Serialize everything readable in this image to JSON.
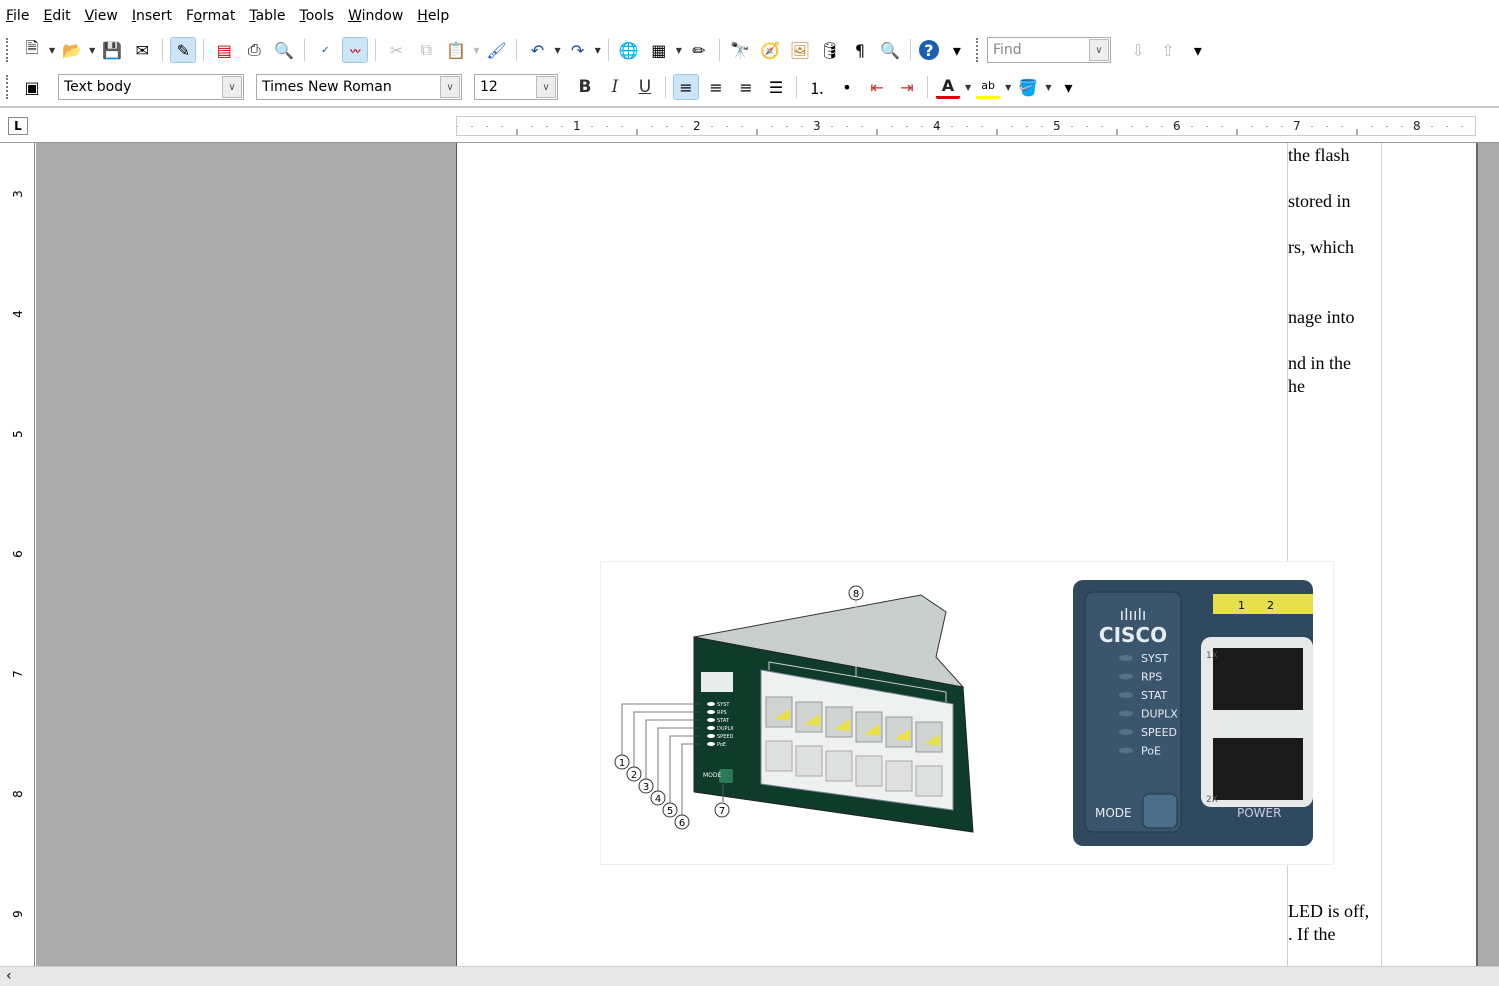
{
  "menubar": {
    "items": [
      {
        "label": "File",
        "u": "F",
        "rest": "ile"
      },
      {
        "label": "Edit",
        "u": "E",
        "rest": "dit"
      },
      {
        "label": "View",
        "u": "V",
        "rest": "iew"
      },
      {
        "label": "Insert",
        "u": "I",
        "rest": "nsert"
      },
      {
        "label": "Format",
        "pre": "F",
        "u": "o",
        "rest": "rmat"
      },
      {
        "label": "Table",
        "u": "T",
        "rest": "able"
      },
      {
        "label": "Tools",
        "u": "T",
        "rest": "ools"
      },
      {
        "label": "Window",
        "u": "W",
        "rest": "indow"
      },
      {
        "label": "Help",
        "u": "H",
        "rest": "elp"
      }
    ]
  },
  "toolbar": {
    "find_placeholder": "Find"
  },
  "formatting": {
    "paragraph_style": "Text body",
    "font_name": "Times New Roman",
    "font_size": "12",
    "bold": "B",
    "italic": "I",
    "underline": "U"
  },
  "ruler": {
    "h_numbers": [
      "1",
      "2",
      "3",
      "4",
      "5",
      "6",
      "7",
      "8"
    ],
    "v_numbers": [
      "3",
      "4",
      "5",
      "6",
      "7",
      "8",
      "9"
    ],
    "tab_type": "L"
  },
  "document": {
    "fragments": [
      "the flash",
      "stored in",
      "rs, which",
      "nage into",
      "nd in the",
      "he",
      "LED is off,",
      ". If the"
    ]
  },
  "figure": {
    "left_callouts": [
      "1",
      "2",
      "3",
      "4",
      "5",
      "6",
      "7",
      "8"
    ],
    "left_leds": [
      "SYST",
      "RPS",
      "STAT",
      "DUPLX",
      "SPEED",
      "PoE"
    ],
    "left_mode": "MODE",
    "right_brand": "CISCO",
    "right_leds": [
      "SYST",
      "RPS",
      "STAT",
      "DUPLX",
      "SPEED",
      "PoE"
    ],
    "right_mode": "MODE",
    "right_ports": [
      "1",
      "2"
    ],
    "right_port_labels": [
      "1X",
      "2X"
    ],
    "right_power": "POWER"
  },
  "colors": {
    "switch_green": "#0f3b2b",
    "switch_blue": "#2f4a60",
    "port_yellow": "#e8e04a",
    "page_gray": "#ababab"
  }
}
